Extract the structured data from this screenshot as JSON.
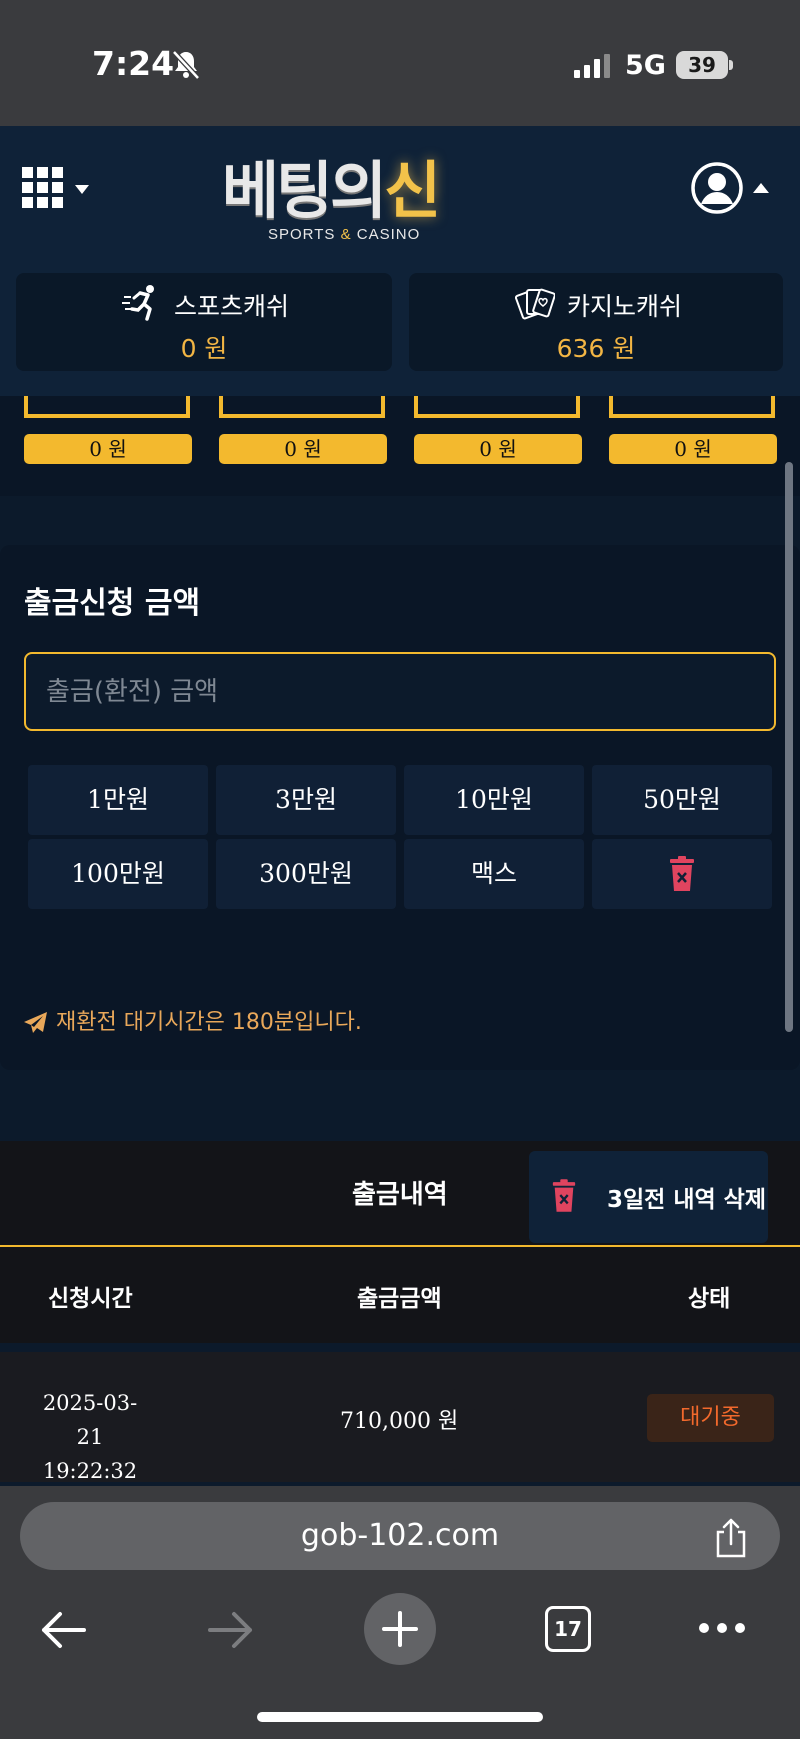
{
  "status_bar": {
    "time": "7:24",
    "network": "5G",
    "battery": "39"
  },
  "header": {
    "logo": {
      "main_a": "베팅의",
      "main_b": "신",
      "sub_a": "SPORTS ",
      "sub_amp": "&",
      "sub_b": " CASINO"
    },
    "menu_icon": "grid-icon",
    "profile_icon": "user-icon"
  },
  "cash": {
    "sports": {
      "label": "스포츠캐쉬",
      "value": "0 원"
    },
    "casino": {
      "label": "카지노캐쉬",
      "value": "636 원"
    }
  },
  "mini_cards": [
    {
      "value": "0 원"
    },
    {
      "value": "0 원"
    },
    {
      "value": "0 원"
    },
    {
      "value": "0 원"
    }
  ],
  "withdraw": {
    "title": "출금신청 금액",
    "placeholder": "출금(환전) 금액",
    "amount_buttons": [
      "1만원",
      "3만원",
      "10만원",
      "50만원",
      "100만원",
      "300만원",
      "맥스"
    ],
    "notice": "재환전 대기시간은 180분입니다."
  },
  "history": {
    "title": "출금내역",
    "delete_label": "3일전 내역 삭제",
    "columns": [
      "신청시간",
      "출금금액",
      "상태"
    ],
    "rows": [
      {
        "date": "2025-03-21",
        "time": "19:22:32",
        "amount": "710,000 원",
        "status": "대기중"
      }
    ]
  },
  "browser": {
    "url": "gob-102.com",
    "tabs": "17"
  },
  "colors": {
    "accent": "#f3b92e",
    "background": "#0c1a2b",
    "status_pending": "#f2692c",
    "notice": "#e9a85a"
  }
}
